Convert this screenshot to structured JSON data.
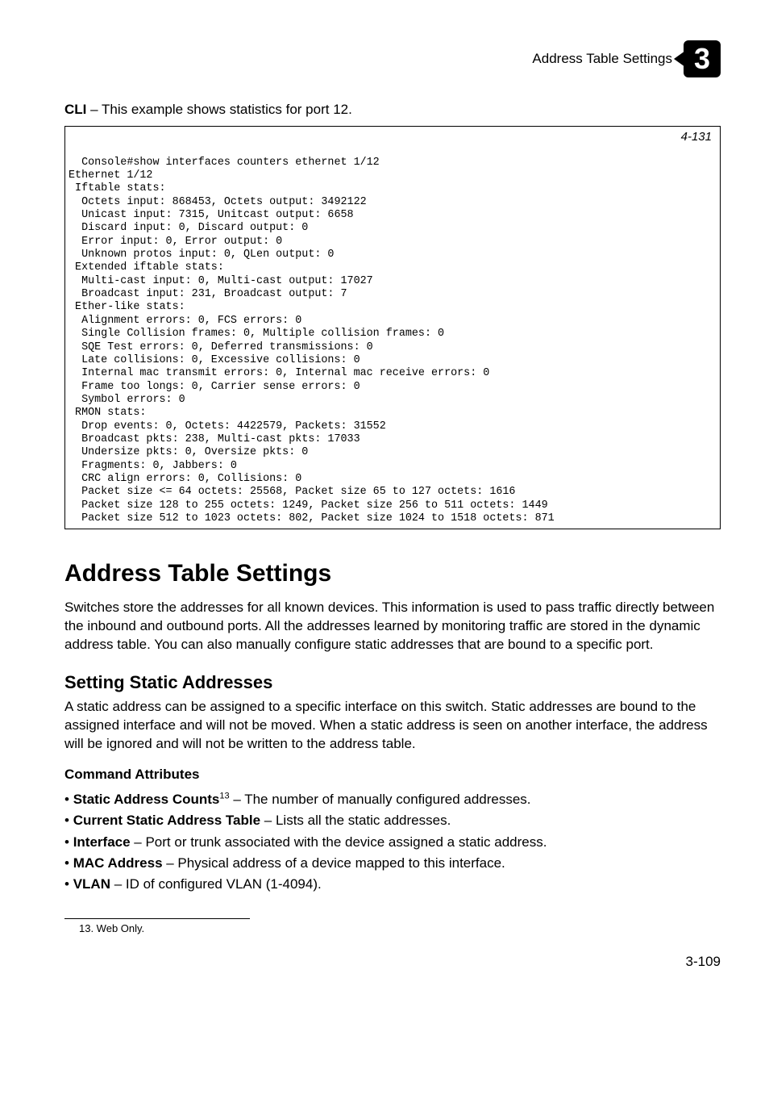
{
  "header": {
    "running_title": "Address Table Settings",
    "chapter_num": "3"
  },
  "cli_intro_prefix": "CLI",
  "cli_intro_rest": " – This example shows statistics for port 12.",
  "code_ref": "4-131",
  "code": "Console#show interfaces counters ethernet 1/12\nEthernet 1/12\n Iftable stats:\n  Octets input: 868453, Octets output: 3492122\n  Unicast input: 7315, Unitcast output: 6658\n  Discard input: 0, Discard output: 0\n  Error input: 0, Error output: 0\n  Unknown protos input: 0, QLen output: 0\n Extended iftable stats:\n  Multi-cast input: 0, Multi-cast output: 17027\n  Broadcast input: 231, Broadcast output: 7\n Ether-like stats:\n  Alignment errors: 0, FCS errors: 0\n  Single Collision frames: 0, Multiple collision frames: 0\n  SQE Test errors: 0, Deferred transmissions: 0\n  Late collisions: 0, Excessive collisions: 0\n  Internal mac transmit errors: 0, Internal mac receive errors: 0\n  Frame too longs: 0, Carrier sense errors: 0\n  Symbol errors: 0\n RMON stats:\n  Drop events: 0, Octets: 4422579, Packets: 31552\n  Broadcast pkts: 238, Multi-cast pkts: 17033\n  Undersize pkts: 0, Oversize pkts: 0\n  Fragments: 0, Jabbers: 0\n  CRC align errors: 0, Collisions: 0\n  Packet size <= 64 octets: 25568, Packet size 65 to 127 octets: 1616\n  Packet size 128 to 255 octets: 1249, Packet size 256 to 511 octets: 1449\n  Packet size 512 to 1023 octets: 802, Packet size 1024 to 1518 octets: 871",
  "section_title": "Address Table Settings",
  "section_body": "Switches store the addresses for all known devices. This information is used to pass traffic directly between the inbound and outbound ports. All the addresses learned by monitoring traffic are stored in the dynamic address table. You can also manually configure static addresses that are bound to a specific port.",
  "subsection_title": "Setting Static Addresses",
  "subsection_body": "A static address can be assigned to a specific interface on this switch. Static addresses are bound to the assigned interface and will not be moved. When a static address is seen on another interface, the address will be ignored and will not be written to the address table.",
  "cmd_attr_heading": "Command Attributes",
  "attrs": [
    {
      "term": "Static Address Counts",
      "sup": "13",
      "desc": " – The number of manually configured addresses."
    },
    {
      "term": "Current Static Address Table",
      "sup": "",
      "desc": " – Lists all the static addresses."
    },
    {
      "term": "Interface",
      "sup": "",
      "desc": " – Port or trunk associated with the device assigned a static address."
    },
    {
      "term": "MAC Address",
      "sup": "",
      "desc": " – Physical address of a device mapped to this interface."
    },
    {
      "term": "VLAN",
      "sup": "",
      "desc": " – ID of configured VLAN (1-4094)."
    }
  ],
  "footnote": "13. Web Only.",
  "page_number": "3-109"
}
